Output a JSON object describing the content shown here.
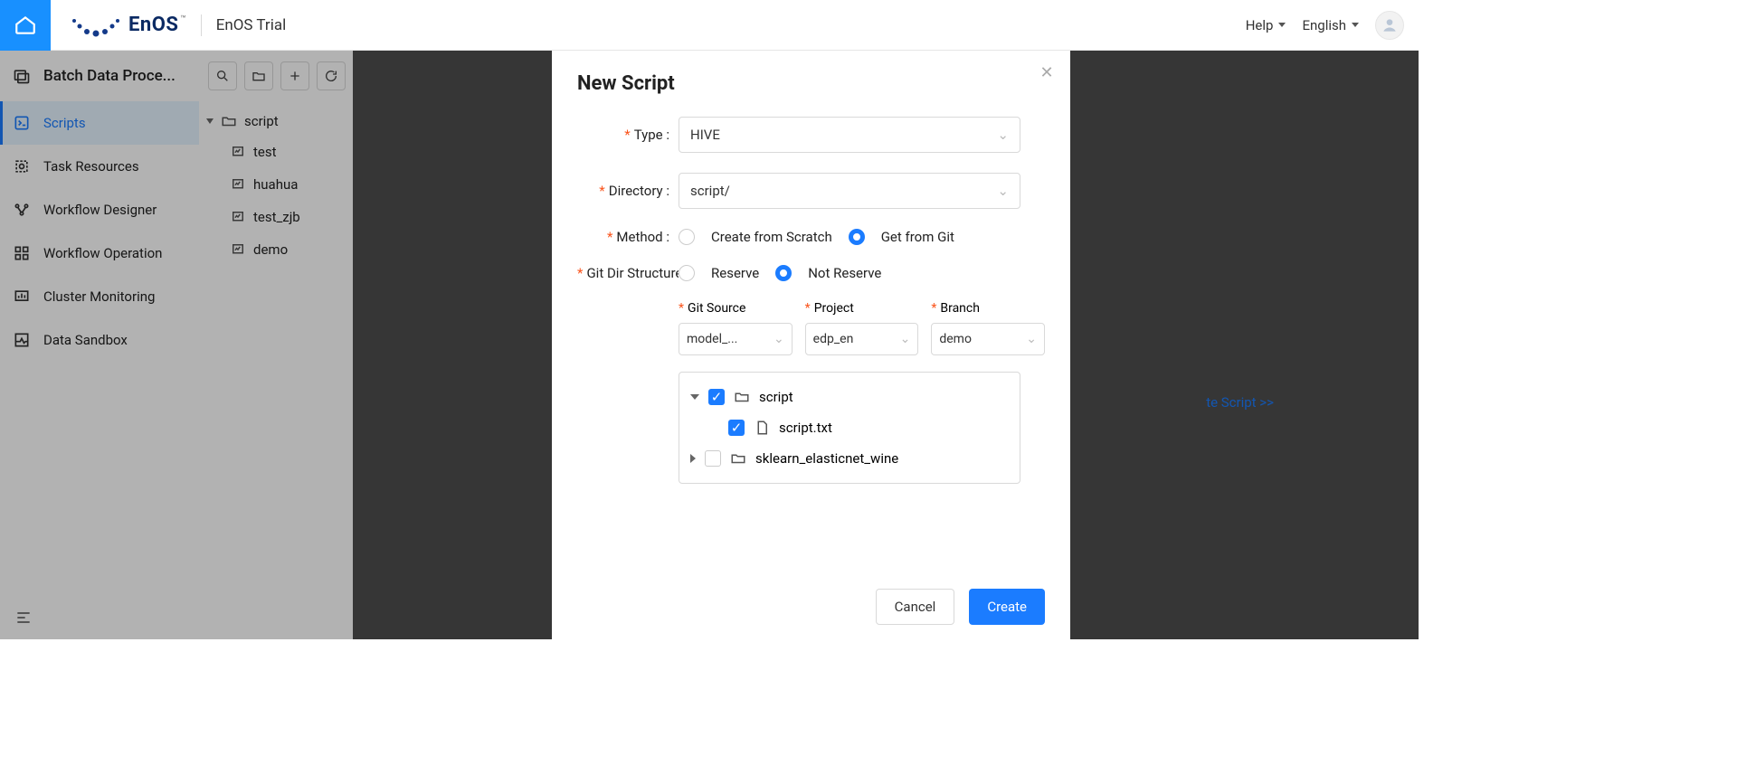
{
  "brand": {
    "name": "EnOS",
    "tm": "™",
    "trial": "EnOS Trial"
  },
  "topbar": {
    "help": "Help",
    "language": "English"
  },
  "sidebar": {
    "title": "Batch Data Proce...",
    "items": [
      {
        "label": "Scripts",
        "active": true
      },
      {
        "label": "Task Resources"
      },
      {
        "label": "Workflow Designer"
      },
      {
        "label": "Workflow Operation"
      },
      {
        "label": "Cluster Monitoring"
      },
      {
        "label": "Data Sandbox"
      }
    ]
  },
  "tree": {
    "folder": "script",
    "files": [
      "test",
      "huahua",
      "test_zjb",
      "demo"
    ]
  },
  "content": {
    "link": "te Script >>"
  },
  "modal": {
    "title": "New Script",
    "type_label": "Type :",
    "type_value": "HIVE",
    "directory_label": "Directory :",
    "directory_value": "script/",
    "method_label": "Method :",
    "method_options": [
      "Create from Scratch",
      "Get from Git"
    ],
    "git_dir_label": "Git Dir Structure",
    "git_dir_options": [
      "Reserve",
      "Not Reserve"
    ],
    "git_source_label": "Git Source",
    "git_source_value": "model_...",
    "project_label": "Project",
    "project_value": "edp_en",
    "branch_label": "Branch",
    "branch_value": "demo",
    "treebox": {
      "folder1": "script",
      "file1": "script.txt",
      "folder2": "sklearn_elasticnet_wine"
    },
    "cancel": "Cancel",
    "create": "Create"
  }
}
